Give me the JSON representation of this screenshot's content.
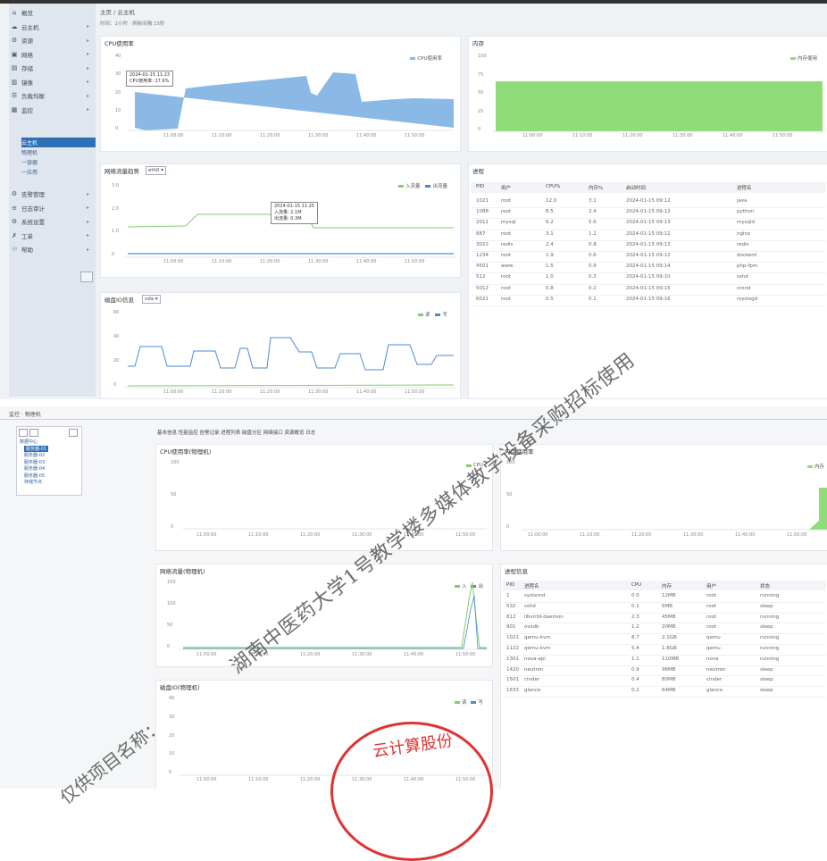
{
  "top": {
    "breadcrumb": "主页 / 云主机",
    "filter_bar": "时间：1小时 · 刷新间隔 15秒",
    "sidebar": {
      "items": [
        {
          "icon": "⌂",
          "label": "概览"
        },
        {
          "icon": "☁",
          "label": "云主机"
        },
        {
          "icon": "⚙",
          "label": "资源"
        },
        {
          "icon": "▣",
          "label": "网络"
        },
        {
          "icon": "▤",
          "label": "存储"
        },
        {
          "icon": "▥",
          "label": "镜像"
        },
        {
          "icon": "☰",
          "label": "负载均衡"
        },
        {
          "icon": "▦",
          "label": "监控"
        }
      ],
      "sub": [
        {
          "label": "云主机"
        },
        {
          "label": "物理机"
        },
        {
          "label": "一容器"
        },
        {
          "label": "一应用"
        }
      ],
      "items2": [
        {
          "icon": "⚙",
          "label": "告警管理"
        },
        {
          "icon": "≡",
          "label": "日志审计"
        },
        {
          "icon": "⚙",
          "label": "系统设置"
        },
        {
          "icon": "✗",
          "label": "工单"
        },
        {
          "icon": "☉",
          "label": "帮助"
        }
      ]
    },
    "cpu": {
      "title": "CPU使用率",
      "legend": "CPU使用率",
      "yticks": [
        "40",
        "30",
        "20",
        "10",
        "0"
      ],
      "xticks": [
        "11:00:00",
        "11:10:00",
        "11:20:00",
        "11:30:00",
        "11:40:00",
        "11:50:00"
      ],
      "tooltip": [
        "2024-01-15 11:23",
        "CPU使用率: 17.9%"
      ]
    },
    "mem": {
      "title": "内存",
      "legend": "内存使用",
      "yticks": [
        "100",
        "75",
        "50",
        "25",
        "0"
      ],
      "xticks": [
        "11:00:00",
        "11:10:00",
        "11:20:00",
        "11:30:00",
        "11:40:00",
        "11:50:00"
      ]
    },
    "net": {
      "title": "网络流量趋势",
      "select": "eth0 ▾",
      "legend_in": "入流量",
      "legend_out": "出流量",
      "yticks": [
        "3.0",
        "2.0",
        "1.0",
        "0"
      ],
      "xticks": [
        "11:00:00",
        "11:10:00",
        "11:20:00",
        "11:30:00",
        "11:40:00",
        "11:50:00"
      ],
      "tooltip": [
        "2024-01-15 11:25",
        "入流量: 2.1M",
        "出流量: 0.3M"
      ]
    },
    "disk": {
      "title": "磁盘IO信息",
      "select": "vda ▾",
      "legend_r": "读",
      "legend_w": "写",
      "yticks": [
        "60",
        "40",
        "20",
        "0"
      ],
      "xticks": [
        "11:00:00",
        "11:10:00",
        "11:20:00",
        "11:30:00",
        "11:40:00",
        "11:50:00"
      ]
    },
    "proc": {
      "title": "进程",
      "headers": [
        "PID",
        "用户",
        "CPU%",
        "内存%",
        "启动时间",
        "进程名"
      ],
      "rows": [
        [
          "1021",
          "root",
          "12.0",
          "3.1",
          "2024-01-15 09:12",
          "java"
        ],
        [
          "1088",
          "root",
          "8.5",
          "2.4",
          "2024-01-15 09:12",
          "python"
        ],
        [
          "2011",
          "mysql",
          "6.2",
          "5.6",
          "2024-01-15 09:13",
          "mysqld"
        ],
        [
          "887",
          "root",
          "3.1",
          "1.2",
          "2024-01-15 09:11",
          "nginx"
        ],
        [
          "3022",
          "redis",
          "2.4",
          "0.8",
          "2024-01-15 09:13",
          "redis"
        ],
        [
          "1234",
          "root",
          "1.9",
          "0.6",
          "2024-01-15 09:12",
          "dockerd"
        ],
        [
          "4501",
          "www",
          "1.5",
          "0.9",
          "2024-01-15 09:14",
          "php-fpm"
        ],
        [
          "512",
          "root",
          "1.0",
          "0.3",
          "2024-01-15 09:10",
          "sshd"
        ],
        [
          "5012",
          "root",
          "0.8",
          "0.2",
          "2024-01-15 09:15",
          "crond"
        ],
        [
          "6021",
          "root",
          "0.5",
          "0.1",
          "2024-01-15 09:16",
          "rsyslogd"
        ]
      ]
    }
  },
  "bottom": {
    "title_bar": "监控 · 物理机",
    "toolbar": "基本信息  性能监控  告警记录  进程列表  磁盘分区  网络接口  资源概览  日志",
    "tree": [
      "数据中心",
      "服务器-01",
      "服务器-02",
      "服务器-03",
      "服务器-04",
      "服务器-05",
      "存储节点"
    ],
    "cpu": {
      "title": "CPU使用率(物理机)",
      "legend": "CPU",
      "yticks": [
        "100",
        "50",
        "0"
      ],
      "xticks": [
        "11:00:00",
        "11:10:00",
        "11:20:00",
        "11:30:00",
        "11:40:00",
        "11:50:00"
      ]
    },
    "mem": {
      "title": "内存使用率",
      "legend": "内存",
      "yticks": [
        "100",
        "50",
        "0"
      ],
      "xticks": [
        "11:00:00",
        "11:10:00",
        "11:20:00",
        "11:30:00",
        "11:40:00",
        "11:50:00"
      ]
    },
    "net": {
      "title": "网络流量(物理机)",
      "legend_in": "入",
      "legend_out": "出",
      "yticks": [
        "150",
        "100",
        "50",
        "0"
      ],
      "xticks": [
        "11:00:00",
        "11:10:00",
        "11:20:00",
        "11:30:00",
        "11:40:00",
        "11:50:00"
      ]
    },
    "disk": {
      "title": "磁盘IO(物理机)",
      "legend_r": "读",
      "legend_w": "写",
      "yticks": [
        "40",
        "30",
        "20",
        "10",
        "0"
      ],
      "xticks": [
        "11:00:00",
        "11:10:00",
        "11:20:00",
        "11:30:00",
        "11:40:00",
        "11:50:00"
      ]
    },
    "proc": {
      "title": "进程信息",
      "headers": [
        "PID",
        "进程名",
        "CPU",
        "内存",
        "用户",
        "状态"
      ],
      "rows": [
        [
          "1",
          "systemd",
          "0.0",
          "12MB",
          "root",
          "running"
        ],
        [
          "532",
          "sshd",
          "0.1",
          "6MB",
          "root",
          "sleep"
        ],
        [
          "812",
          "libvirtd-daemon",
          "2.3",
          "45MB",
          "root",
          "running"
        ],
        [
          "901",
          "ovsdb",
          "1.2",
          "20MB",
          "root",
          "sleep"
        ],
        [
          "1021",
          "qemu-kvm",
          "8.7",
          "2.1GB",
          "qemu",
          "running"
        ],
        [
          "1122",
          "qemu-kvm",
          "5.4",
          "1.8GB",
          "qemu",
          "running"
        ],
        [
          "1301",
          "nova-api",
          "1.1",
          "110MB",
          "nova",
          "running"
        ],
        [
          "1420",
          "neutron",
          "0.9",
          "96MB",
          "neutron",
          "sleep"
        ],
        [
          "1501",
          "cinder",
          "0.4",
          "80MB",
          "cinder",
          "sleep"
        ],
        [
          "1633",
          "glance",
          "0.2",
          "64MB",
          "glance",
          "sleep"
        ]
      ]
    }
  },
  "watermark": {
    "line1": "湖南中医药大学1号教学楼多媒体教学设备采购招标使用",
    "line2": "仅供项目名称：",
    "stamp": "云计算股份"
  },
  "colors": {
    "accent": "#2f6fb6",
    "cpu_fill": "#8ab9e6",
    "mem_fill": "#8fdc78",
    "line_green": "#7fcf6a",
    "line_blue": "#4a8ad4",
    "stamp": "#d33"
  }
}
